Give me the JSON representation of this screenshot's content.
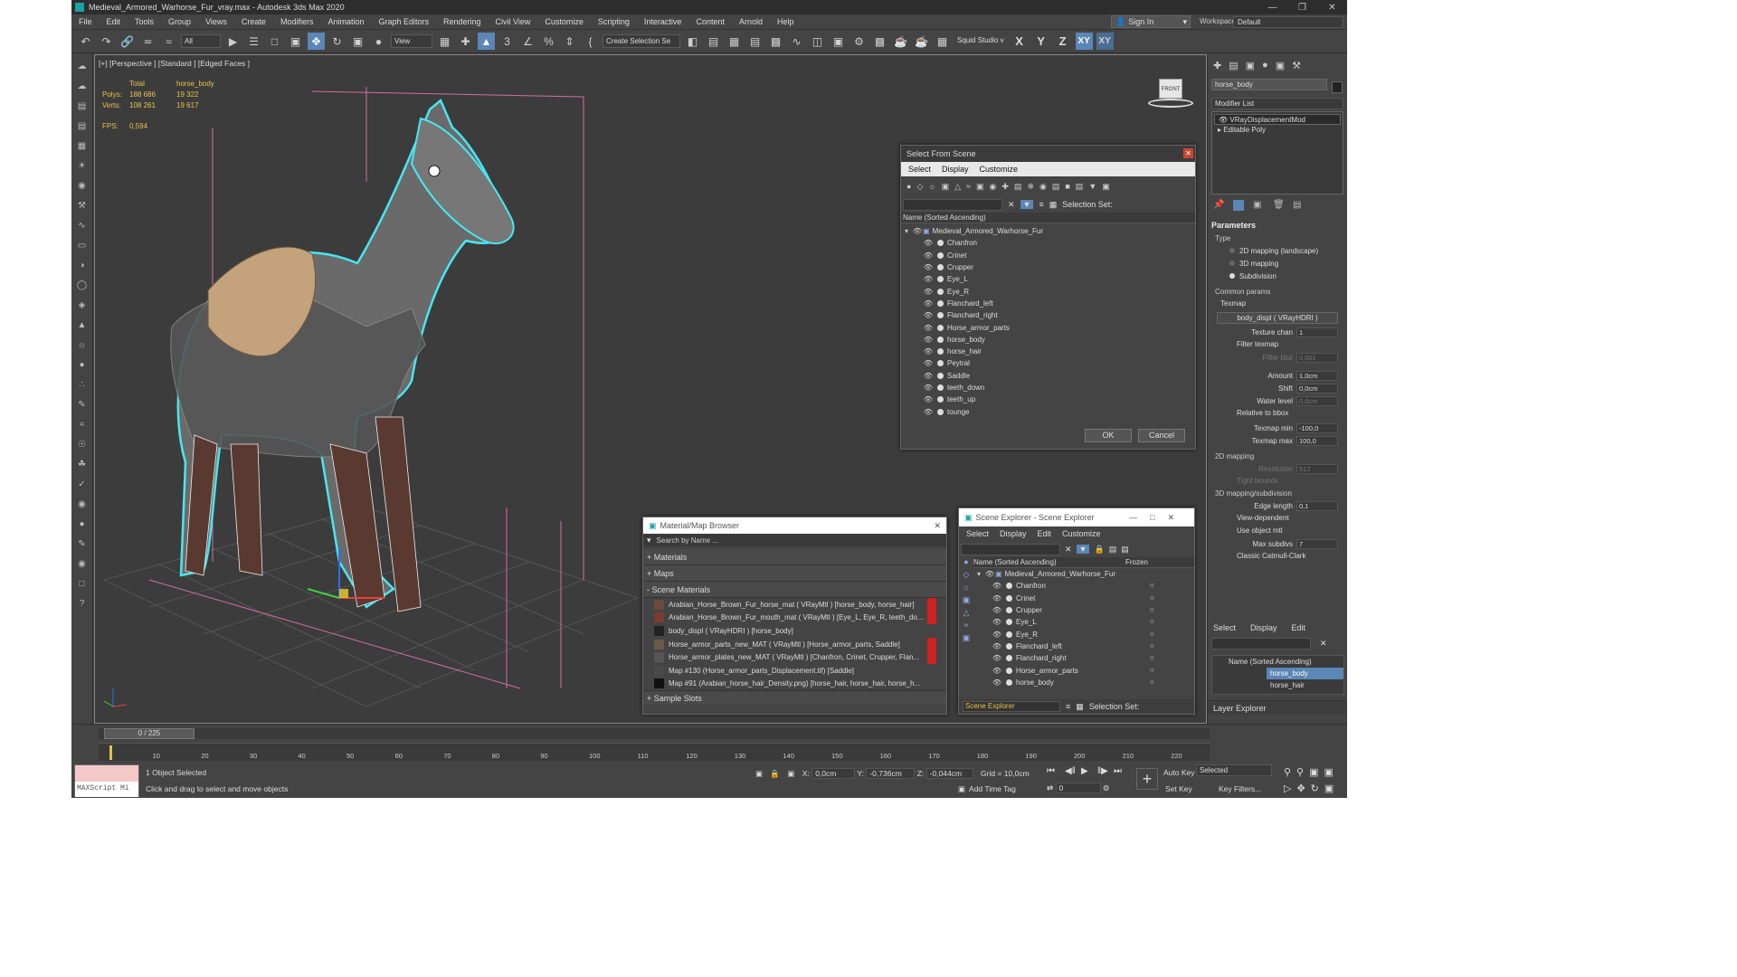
{
  "app": {
    "title": "Medieval_Armored_Warhorse_Fur_vray.max - Autodesk 3ds Max 2020"
  },
  "menu": [
    "File",
    "Edit",
    "Tools",
    "Group",
    "Views",
    "Create",
    "Modifiers",
    "Animation",
    "Graph Editors",
    "Rendering",
    "Civil View",
    "Customize",
    "Scripting",
    "Interactive",
    "Content",
    "Arnold",
    "Help"
  ],
  "account": {
    "signin": "Sign In",
    "workspaces_label": "Workspaces:",
    "workspace": "Default"
  },
  "toolbar": {
    "filter": "All",
    "refcoord": "View",
    "selset": "Create Selection Se",
    "squid": "Squid Studio v",
    "x": "X",
    "y": "Y",
    "z": "Z",
    "xy": "XY",
    "xyz": "XY"
  },
  "viewport": {
    "label": "[+] [Perspective ] [Standard ] [Edged Faces ]",
    "stats": {
      "col1": "Total",
      "col2": "horse_body",
      "polys_label": "Polys:",
      "polys_total": "188 686",
      "polys_obj": "19 322",
      "verts_label": "Verts:",
      "verts_total": "108 261",
      "verts_obj": "19 617",
      "fps_label": "FPS:",
      "fps": "0,594"
    },
    "viewcube": "FRONT"
  },
  "select_from_scene": {
    "title": "Select From Scene",
    "menus": [
      "Select",
      "Display",
      "Customize"
    ],
    "selection_set": "Selection Set:",
    "col_header": "Name (Sorted Ascending)",
    "root": "Medieval_Armored_Warhorse_Fur",
    "items": [
      "Chanfron",
      "Crinet",
      "Crupper",
      "Eye_L",
      "Eye_R",
      "Flanchard_left",
      "Flanchard_right",
      "Horse_armor_parts",
      "horse_body",
      "horse_hair",
      "Peytral",
      "Saddle",
      "teeth_down",
      "teeth_up",
      "tounge"
    ],
    "ok": "OK",
    "cancel": "Cancel"
  },
  "material_browser": {
    "title": "Material/Map Browser",
    "search": "Search by Name ...",
    "sections": {
      "materials": "+ Materials",
      "maps": "+ Maps",
      "scene": "- Scene Materials",
      "slots": "+ Sample Slots"
    },
    "scene_materials": [
      "Arabian_Horse_Brown_Fur_horse_mat  ( VRayMtl ) [horse_body, horse_hair]",
      "Arabian_Horse_Brown_Fur_mouth_mat  ( VRayMtl ) [Eye_L, Eye_R, teeth_do...",
      "body_displ  ( VRayHDRI ) [horse_body]",
      "Horse_armor_parts_new_MAT  ( VRayMtl ) [Horse_armor_parts, Saddle]",
      "Horse_armor_plates_new_MAT  ( VRayMtl ) [Chanfron, Crinet, Crupper, Flan...",
      "Map #130 (Horse_armor_parts_Displacement.tif) [Saddle]",
      "Map #91 (Arabian_horse_hair_Density.png) [horse_hair, horse_hair, horse_h..."
    ]
  },
  "scene_explorer": {
    "title": "Scene Explorer - Scene Explorer",
    "menus": [
      "Select",
      "Display",
      "Edit",
      "Customize"
    ],
    "col_name": "Name (Sorted Ascending)",
    "col_frozen": "Frozen",
    "root": "Medieval_Armored_Warhorse_Fur",
    "items": [
      "Chanfron",
      "Crinet",
      "Crupper",
      "Eye_L",
      "Eye_R",
      "Flanchard_left",
      "Flanchard_right",
      "Horse_armor_parts",
      "horse_body"
    ],
    "footer": "Scene Explorer",
    "selection_set": "Selection Set:"
  },
  "command_panel": {
    "object_name": "horse_body",
    "modifier_list": "Modifier List",
    "stack": [
      "VRayDisplacementMod",
      "Editable Poly"
    ],
    "parameters": "Parameters",
    "type": "Type",
    "types": [
      "2D mapping (landscape)",
      "3D mapping",
      "Subdivision"
    ],
    "common": "Common params",
    "texmap": "Texmap",
    "texmap_btn": "body_displ  ( VRayHDRI )",
    "texture_chan": "Texture chan",
    "texture_chan_v": "1",
    "filter_texmap": "Filter texmap",
    "filter_blur": "Filter blur",
    "filter_blur_v": "0,001",
    "amount": "Amount",
    "amount_v": "1,0cm",
    "shift": "Shift",
    "shift_v": "0,0cm",
    "water": "Water level",
    "water_v": "0,0cm",
    "relative": "Relative to bbox",
    "tmin": "Texmap min",
    "tmin_v": "-100,0",
    "tmax": "Texmap max",
    "tmax_v": "100,0",
    "map2d": "2D mapping",
    "res": "Resolution",
    "res_v": "512",
    "tight": "Tight bounds",
    "map3d": "3D mapping/subdivision",
    "edge": "Edge length",
    "edge_v": "0,1",
    "view": "View-dependent",
    "useobj": "Use object mtl",
    "maxsub": "Max subdivs",
    "maxsub_v": "7",
    "catmull": "Classic Catmull-Clark"
  },
  "layer_explorer": {
    "menus": [
      "Select",
      "Display",
      "Edit"
    ],
    "col": "Name (Sorted Ascending)",
    "items": [
      "horse_body",
      "horse_hair"
    ],
    "footer": "Layer Explorer"
  },
  "status": {
    "frame": "0 / 225",
    "ticks": [
      "10",
      "20",
      "30",
      "40",
      "50",
      "60",
      "70",
      "80",
      "90",
      "100",
      "110",
      "120",
      "130",
      "140",
      "150",
      "160",
      "170",
      "180",
      "190",
      "200",
      "210",
      "220"
    ],
    "maxscript": "MAXScript Mi",
    "selected": "1 Object Selected",
    "prompt": "Click and drag to select and move objects",
    "x": "X:",
    "xv": "0,0cm",
    "y": "Y:",
    "yv": "-0,736cm",
    "z": "Z:",
    "zv": "-0,044cm",
    "grid": "Grid = 10,0cm",
    "addtag": "Add Time Tag",
    "autokey": "Auto Key",
    "selected_drop": "Selected",
    "setkey": "Set Key",
    "keyfilters": "Key Filters...",
    "frame_field": "0"
  }
}
